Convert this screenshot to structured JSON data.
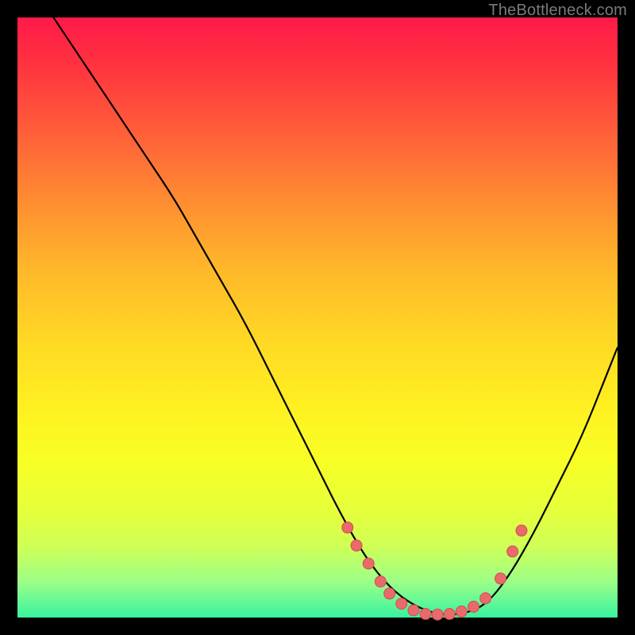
{
  "attribution": "TheBottleneck.com",
  "colors": {
    "dot_fill": "#e86a6a",
    "dot_stroke": "#d44d4d",
    "curve": "#000000",
    "frame_bg_top": "#ff1a49",
    "frame_bg_bottom": "#37f3a0",
    "page_bg": "#000000"
  },
  "chart_data": {
    "type": "line",
    "title": "",
    "xlabel": "",
    "ylabel": "",
    "xlim": [
      0,
      100
    ],
    "ylim": [
      0,
      100
    ],
    "note": "Axes are unlabeled; values are estimated as percentages of plot area (x left→right, y value = distance above bottom).",
    "series": [
      {
        "name": "curve",
        "x": [
          6,
          10,
          14,
          18,
          22,
          26,
          30,
          34,
          38,
          42,
          46,
          50,
          54,
          58,
          62,
          66,
          70,
          74,
          78,
          82,
          86,
          90,
          94,
          98,
          100
        ],
        "y": [
          100,
          94,
          88,
          82,
          76,
          70,
          63,
          56,
          49,
          41,
          33,
          25,
          17,
          10,
          5,
          2,
          0.5,
          0.5,
          2,
          7,
          14,
          22,
          30,
          40,
          45
        ]
      }
    ],
    "points": {
      "name": "markers",
      "x": [
        55.0,
        56.5,
        58.5,
        60.5,
        62.0,
        64.0,
        66.0,
        68.0,
        70.0,
        72.0,
        74.0,
        76.0,
        78.0,
        80.5,
        82.5,
        84.0
      ],
      "y": [
        15.0,
        12.0,
        9.0,
        6.0,
        4.0,
        2.3,
        1.2,
        0.6,
        0.5,
        0.6,
        1.0,
        1.8,
        3.2,
        6.5,
        11.0,
        14.5
      ]
    }
  }
}
